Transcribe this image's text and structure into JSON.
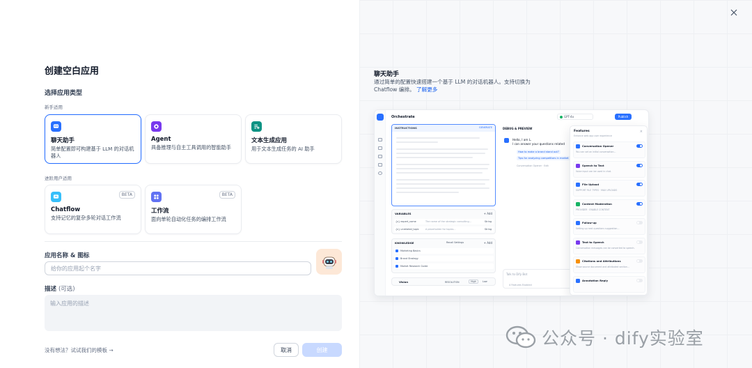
{
  "dialog": {
    "title": "创建空白应用",
    "close_icon": "close-icon"
  },
  "app_type": {
    "section_title": "选择应用类型",
    "beginner_label": "新手适用",
    "advanced_label": "进阶用户适用",
    "beginner_cards": [
      {
        "name": "聊天助手",
        "desc": "简单配置即可构建基于 LLM 的对话机器人",
        "icon": "chat-bubble-icon",
        "color": "#2970ff",
        "selected": true
      },
      {
        "name": "Agent",
        "desc": "具备推理与自主工具调用的智能助手",
        "icon": "robot-icon",
        "color": "#7839ee",
        "selected": false
      },
      {
        "name": "文本生成应用",
        "desc": "用于文本生成任务的 AI 助手",
        "icon": "text-icon",
        "color": "#0e9384",
        "selected": false
      }
    ],
    "advanced_cards": [
      {
        "name": "Chatflow",
        "desc": "支持记忆的复杂多轮对话工作流",
        "icon": "chatflow-icon",
        "color": "#36bffa",
        "badge": "BETA"
      },
      {
        "name": "工作流",
        "desc": "面向单轮自动化任务的编排工作流",
        "icon": "workflow-icon",
        "color": "#6172f3",
        "badge": "BETA"
      }
    ]
  },
  "form": {
    "name_label": "应用名称 & 图标",
    "name_placeholder": "给你的应用起个名字",
    "desc_label": "描述",
    "desc_optional": "(可选)",
    "desc_placeholder": "输入应用的描述"
  },
  "footer": {
    "template_link": "没有想法？试试我们的模板 →",
    "cancel": "取消",
    "create": "创建"
  },
  "preview": {
    "title": "聊天助手",
    "desc": "通过简单的配置快速搭建一个基于 LLM 的对话机器人。支持切换为 Chatflow 编排。",
    "learn_more": "了解更多",
    "mock": {
      "header": "Orchestrate",
      "model": "GPT-4o",
      "publish": "Publish",
      "instructions": "INSTRUCTIONS",
      "generate": "GENERATE",
      "debug": "DEBUG & PREVIEW",
      "greeting": "Hello, I am L.",
      "greeting2": "I can answer your questions related",
      "sugg1": "How to make a brand stand out?",
      "sugg2": "Tips for analyzing competitors in market",
      "opener": "Conversation Opener · Edit",
      "variables": "VARIABLES",
      "add": "+ Add",
      "var_rows": [
        {
          "key": "{x} expert_name",
          "desc": "The name of the strategic consulting...",
          "type": "String"
        },
        {
          "key": "{x} unrelated_topic",
          "desc": "A placeholder for topics...",
          "type": "String"
        }
      ],
      "knowledge": "KNOWLEDGE",
      "recall": "Recall Settings",
      "kb": [
        "Marketing Basics",
        "Brand Strategy",
        "Market Research Guide"
      ],
      "vision": "Vision",
      "resolution": "RESOLUTION",
      "high": "High",
      "low": "Low",
      "chat_placeholder": "Talk to Dify Bot",
      "features_enabled": "4 Features Enabled",
      "features_title": "Features",
      "features_sub": "Enhance web app user experience",
      "features": [
        {
          "name": "Conversation Opener",
          "desc": "You can set an initial conversation...",
          "on": true,
          "color": "#2970ff"
        },
        {
          "name": "Speech to Text",
          "desc": "Voice input can be used in chat.",
          "on": true,
          "color": "#7839ee"
        },
        {
          "name": "File Upload",
          "desc": "SUPPORT FILE TYPES · MAX UPLOADS",
          "on": true,
          "color": "#2970ff"
        },
        {
          "name": "Content Moderation",
          "desc": "PROVIDER · ENABLE CONTENT",
          "on": true,
          "color": "#16b364"
        },
        {
          "name": "Follow-up",
          "desc": "Setting up next questions suggestion...",
          "on": false,
          "color": "#2970ff"
        },
        {
          "name": "Text to Speech",
          "desc": "Conversation messages can be converted to speech.",
          "on": false,
          "color": "#7839ee"
        },
        {
          "name": "Citations and Attributions",
          "desc": "Show source document and attributed section...",
          "on": false,
          "color": "#f79009"
        },
        {
          "name": "Annotation Reply",
          "desc": "",
          "on": false,
          "color": "#2970ff"
        }
      ]
    }
  },
  "watermark": {
    "text": "公众号 · dify实验室"
  }
}
